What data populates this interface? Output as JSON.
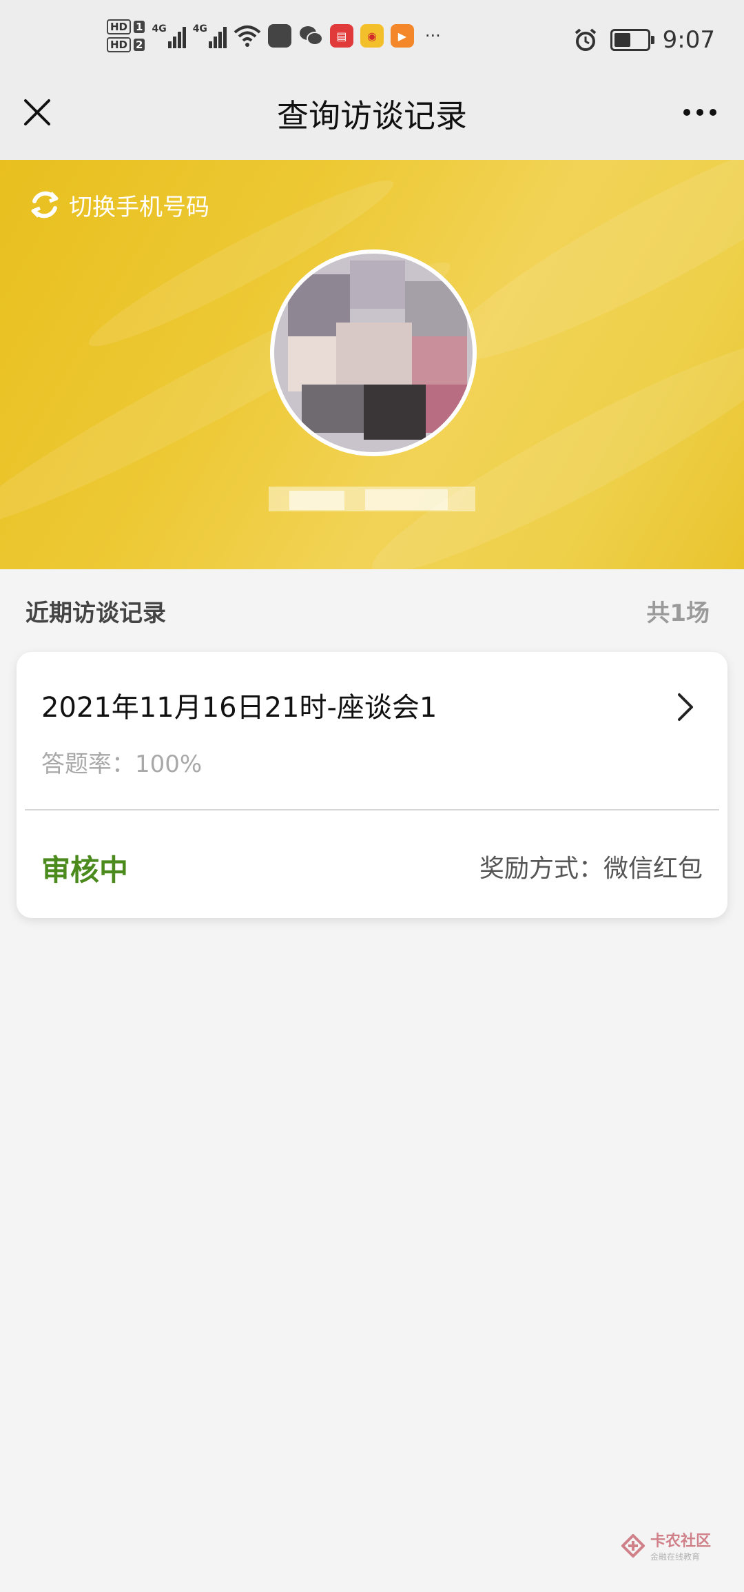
{
  "status_bar": {
    "sim1": "HD",
    "sim1_num": "1",
    "sim2": "HD",
    "sim2_num": "2",
    "net1": "4G",
    "net2": "4G",
    "more": "···",
    "time": "9:07",
    "icons": [
      "signal-icon",
      "wifi-icon",
      "huawei-app-icon",
      "wechat-icon",
      "book-app-icon",
      "weibo-icon",
      "video-app-icon",
      "alarm-icon",
      "battery-icon"
    ]
  },
  "header": {
    "title": "查询访谈记录"
  },
  "banner": {
    "switch_label": "切换手机号码",
    "background_color": "#ecc52e"
  },
  "section": {
    "title": "近期访谈记录",
    "count": "共1场"
  },
  "records": [
    {
      "title": "2021年11月16日21时-座谈会1",
      "rate": "答题率：100%",
      "status": "审核中",
      "reward": "奖励方式：微信红包"
    }
  ],
  "colors": {
    "status_green": "#4b8a1c",
    "banner_yellow": "#ecc52e"
  },
  "watermark": {
    "main": "卡农社区",
    "sub": "金融在线教育"
  }
}
